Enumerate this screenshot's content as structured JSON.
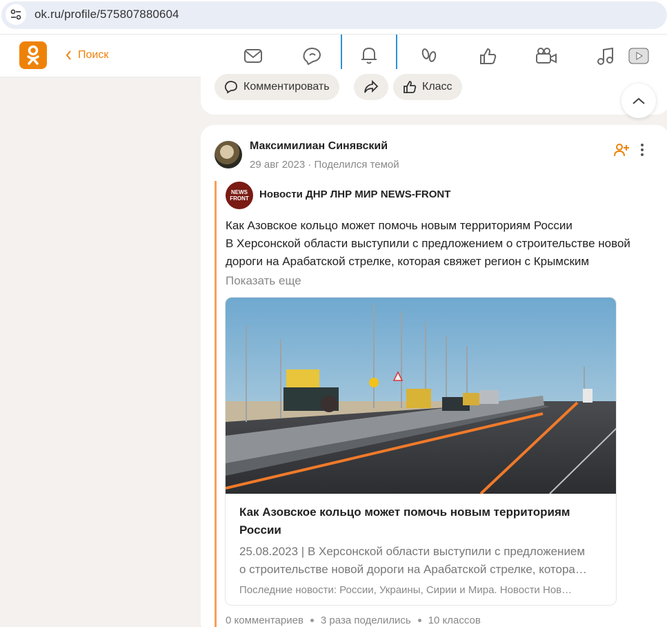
{
  "browser": {
    "url": "ok.ru/profile/575807880604"
  },
  "nav": {
    "back_label": "Поиск",
    "icons": [
      "mail-icon",
      "chat-icon",
      "bell-icon",
      "footprints-icon",
      "thumbs-up-icon",
      "video-camera-icon",
      "music-icon",
      "video-play-icon"
    ],
    "active_icon": "bell-icon",
    "accent_color": "#ee8208"
  },
  "prev_post_actions": {
    "comment_label": "Комментировать",
    "class_label": "Класс"
  },
  "post": {
    "author": "Максимилиан Синявский",
    "date": "29 авг 2023",
    "action": "Поделился темой",
    "group": {
      "logo_line1": "NEWS",
      "logo_line2": "FRONT",
      "name": "Новости ДНР ЛНР МИР NEWS-FRONT"
    },
    "text_line1": "Как Азовское кольцо может помочь новым территориям России",
    "text_line2": "В Херсонской области выступили с предложением о строительстве новой дороги на Арабатской стрелке, которая свяжет регион с Крымским",
    "show_more": "Показать еще",
    "link": {
      "title": "Как Азовское кольцо может помочь новым территориям России",
      "desc_line1": "25.08.2023 | В Херсонской области выступили с предложением",
      "desc_line2": "о строительстве новой дороги на Арабатской стрелке, котора…",
      "source": "Последние новости: России, Украины, Сирии и Мира. Новости Нов…"
    },
    "stats": {
      "comments": "0 комментариев",
      "shares": "3 раза поделились",
      "likes": "10 классов"
    }
  }
}
